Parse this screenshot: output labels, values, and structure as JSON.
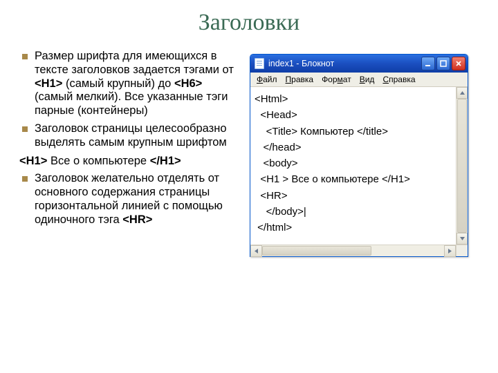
{
  "title": "Заголовки",
  "bullets": {
    "b1a": "Размер шрифта для имеющихся в тексте заголовков задается тэгами от ",
    "b1b": "<H1>",
    "b1c": " (самый крупный) до ",
    "b1d": "<H6>",
    "b1e": " (самый мелкий). Все указанные тэги парные (контейнеры)",
    "b2": "Заголовок страницы целесообразно выделять самым крупным шрифтом",
    "h1a": "<H1>",
    "h1b": " Все о компьютере ",
    "h1c": "</H1>",
    "b3a": "Заголовок желательно отделять от основного содержания страницы горизонтальной линией с помощью одиночного тэга ",
    "b3b": "<HR>"
  },
  "notepad": {
    "title": "index1 - Блокнот",
    "menu": {
      "file_u": "Ф",
      "file_r": "айл",
      "edit_u": "П",
      "edit_r": "равка",
      "fmt_r1": "Фор",
      "fmt_u": "м",
      "fmt_r2": "ат",
      "view_u": "В",
      "view_r": "ид",
      "help_u": "С",
      "help_r": "правка"
    },
    "code": "<Html>\n  <Head>\n    <Title> Компьютер </title>\n   </head>\n   <body>\n  <H1 > Все о компьютере </H1>\n  <HR>\n    </body>|\n </html>"
  }
}
